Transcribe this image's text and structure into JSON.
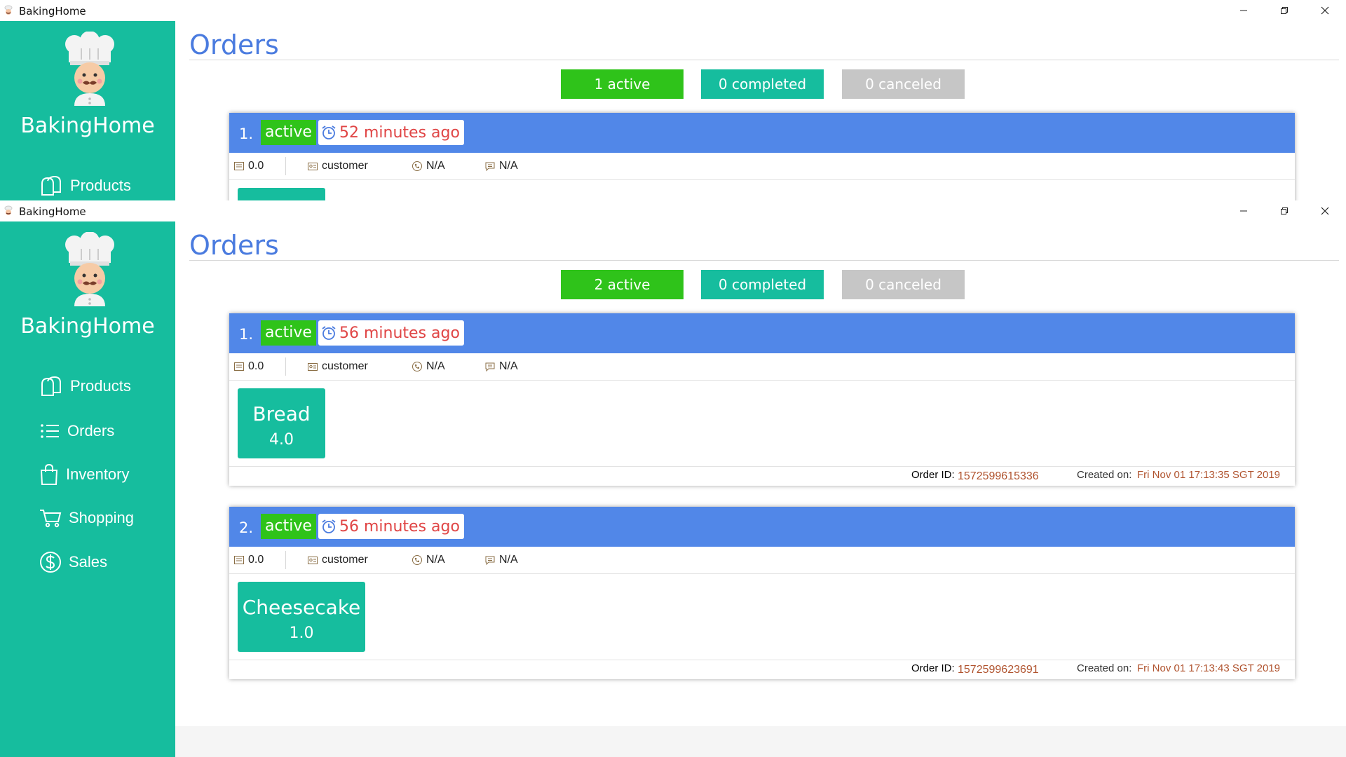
{
  "window1": {
    "title": "BakingHome",
    "brand": "BakingHome",
    "nav": [
      {
        "label": "Products",
        "icon": "bread-icon"
      }
    ],
    "page_title": "Orders",
    "filters": {
      "active": "1 active",
      "completed": "0 completed",
      "canceled": "0 canceled"
    },
    "orders": [
      {
        "number": "1.",
        "status": "active",
        "time": "52 minutes ago",
        "price": "0.0",
        "customer": "customer",
        "phone": "N/A",
        "note": "N/A"
      }
    ]
  },
  "window2": {
    "title": "BakingHome",
    "brand": "BakingHome",
    "nav": [
      {
        "label": "Products",
        "icon": "bread-icon"
      },
      {
        "label": "Orders",
        "icon": "list-icon"
      },
      {
        "label": "Inventory",
        "icon": "bag-icon"
      },
      {
        "label": "Shopping",
        "icon": "cart-icon"
      },
      {
        "label": "Sales",
        "icon": "dollar-icon"
      }
    ],
    "page_title": "Orders",
    "filters": {
      "active": "2 active",
      "completed": "0 completed",
      "canceled": "0 canceled"
    },
    "order_id_label": "Order ID:",
    "created_label": "Created on:",
    "orders": [
      {
        "number": "1.",
        "status": "active",
        "time": "56 minutes ago",
        "price": "0.0",
        "customer": "customer",
        "phone": "N/A",
        "note": "N/A",
        "items": [
          {
            "name": "Bread",
            "qty": "4.0"
          }
        ],
        "order_id": "1572599615336",
        "created": "Fri Nov 01 17:13:35 SGT 2019"
      },
      {
        "number": "2.",
        "status": "active",
        "time": "56 minutes ago",
        "price": "0.0",
        "customer": "customer",
        "phone": "N/A",
        "note": "N/A",
        "items": [
          {
            "name": "Cheesecake",
            "qty": "1.0"
          }
        ],
        "order_id": "1572599623691",
        "created": "Fri Nov 01 17:13:43 SGT 2019"
      }
    ]
  },
  "colors": {
    "sidebar": "#16bd9e",
    "title_blue": "#4a7bdf",
    "header_blue": "#5187e8",
    "status_green": "#2fc31a",
    "time_red": "#e04545",
    "disabled": "#c6c6c6"
  }
}
